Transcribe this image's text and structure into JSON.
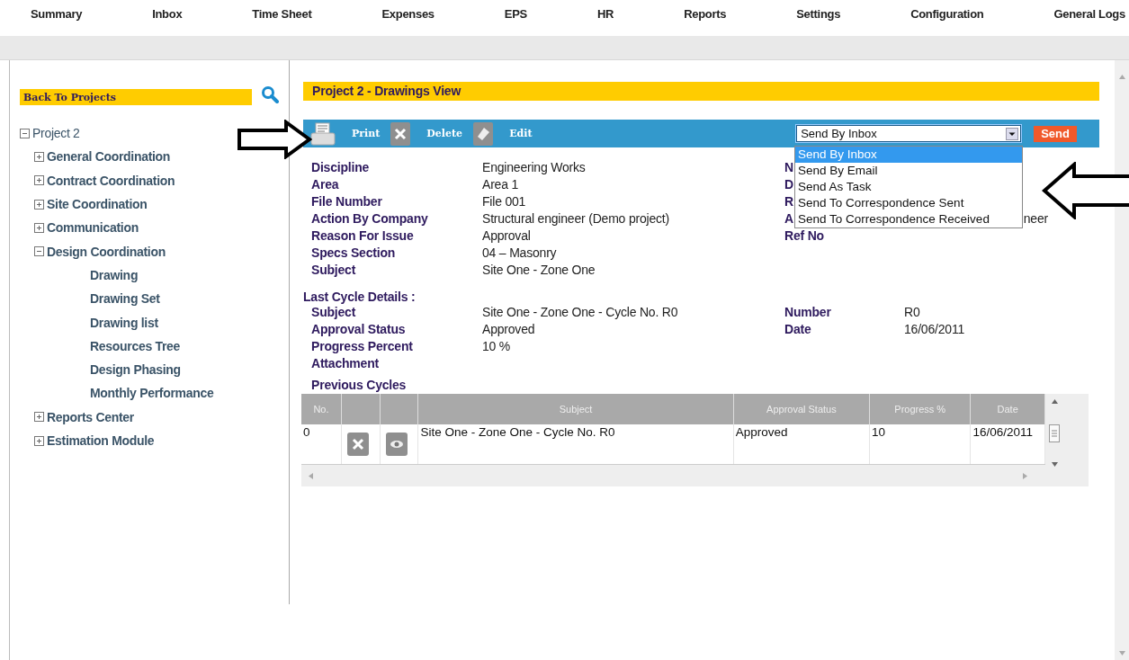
{
  "nav": [
    {
      "label": "Summary"
    },
    {
      "label": "Inbox"
    },
    {
      "label": "Time Sheet"
    },
    {
      "label": "Expenses"
    },
    {
      "label": "EPS"
    },
    {
      "label": "HR"
    },
    {
      "label": "Reports"
    },
    {
      "label": "Settings"
    },
    {
      "label": "Configuration"
    },
    {
      "label": "General Logs"
    }
  ],
  "sidebar": {
    "back_button": "Back To Projects",
    "tree": {
      "label": "Project 2",
      "expanded": true,
      "children": [
        {
          "label": "General Coordination",
          "expanded": false
        },
        {
          "label": "Contract Coordination",
          "expanded": false
        },
        {
          "label": "Site Coordination",
          "expanded": false
        },
        {
          "label": "Communication",
          "expanded": false
        },
        {
          "label": "Design Coordination",
          "expanded": true,
          "children": [
            {
              "label": "Drawing"
            },
            {
              "label": "Drawing Set"
            },
            {
              "label": "Drawing list"
            },
            {
              "label": "Resources Tree"
            },
            {
              "label": "Design Phasing"
            },
            {
              "label": "Monthly Performance"
            }
          ]
        },
        {
          "label": "Reports Center",
          "expanded": false
        },
        {
          "label": "Estimation Module",
          "expanded": false
        }
      ]
    }
  },
  "title": "Project 2 - Drawings View",
  "toolbar": {
    "buttons": [
      {
        "kind": "print",
        "label": "Print"
      },
      {
        "kind": "delete",
        "label": "Delete"
      },
      {
        "kind": "edit",
        "label": "Edit"
      }
    ],
    "send_select": {
      "value": "Send By Inbox",
      "expanded": true,
      "options": [
        {
          "label": "Send By Inbox",
          "selected": true
        },
        {
          "label": "Send By Email",
          "selected": false
        },
        {
          "label": "Send As Task",
          "selected": false
        },
        {
          "label": "Send To Correspondence Sent",
          "selected": false
        },
        {
          "label": "Send To Correspondence Received",
          "selected": false
        }
      ]
    },
    "send_button": "Send"
  },
  "details": {
    "fields": [
      {
        "label": "Discipline",
        "value": "Engineering Works"
      },
      {
        "label": "Area",
        "value": "Area 1"
      },
      {
        "label": "File Number",
        "value": "File 001"
      },
      {
        "label": "Action By Company",
        "value": "Structural engineer (Demo project)"
      },
      {
        "label": "Reason For Issue",
        "value": "Approval"
      },
      {
        "label": "Specs Section",
        "value": "04 – Masonry"
      },
      {
        "label": "Subject",
        "value": "Site One - Zone One"
      }
    ],
    "right_fields": [
      {
        "label": "N"
      },
      {
        "label": "D"
      },
      {
        "label": "R"
      },
      {
        "label": "A",
        "value": "neer"
      },
      {
        "label": "Ref No"
      }
    ]
  },
  "last_cycle": {
    "heading": "Last Cycle Details :",
    "fields": [
      {
        "label": "Subject",
        "value": "Site One - Zone One - Cycle No. R0"
      },
      {
        "label": "Approval Status",
        "value": "Approved"
      },
      {
        "label": "Progress Percent",
        "value": "10 %"
      },
      {
        "label": "Attachment"
      }
    ],
    "right_fields": [
      {
        "label": "Number",
        "value": "R0"
      },
      {
        "label": "Date",
        "value": "16/06/2011"
      }
    ]
  },
  "previous_cycles": {
    "heading": "Previous Cycles",
    "columns": [
      {
        "kind": "text",
        "label": "No."
      },
      {
        "kind": "action"
      },
      {
        "kind": "action"
      },
      {
        "kind": "text",
        "label": "Subject"
      },
      {
        "kind": "text",
        "label": "Approval Status"
      },
      {
        "kind": "text",
        "label": "Progress %"
      },
      {
        "kind": "text",
        "label": "Date"
      }
    ],
    "rows": [
      {
        "cells": [
          {
            "kind": "text",
            "text": "0"
          },
          {
            "kind": "delete"
          },
          {
            "kind": "view"
          },
          {
            "kind": "text",
            "text": "Site One - Zone One - Cycle No. R0"
          },
          {
            "kind": "text",
            "text": "Approved"
          },
          {
            "kind": "text",
            "text": "10"
          },
          {
            "kind": "text",
            "text": "16/06/2011"
          }
        ]
      }
    ]
  }
}
